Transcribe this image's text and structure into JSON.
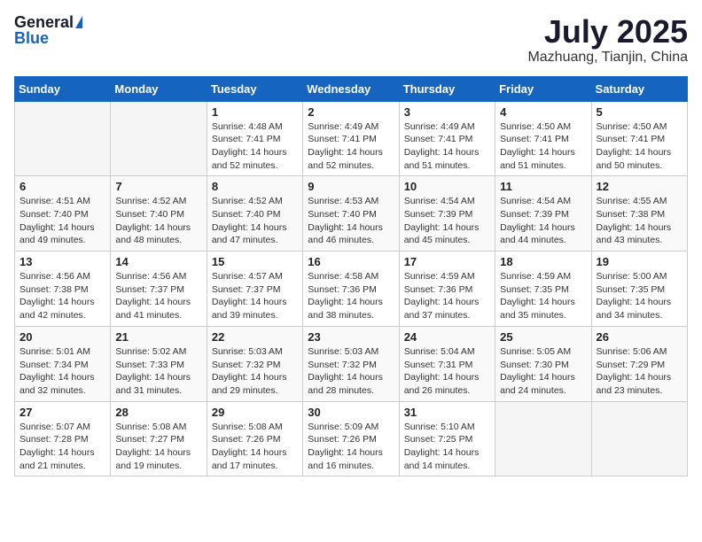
{
  "header": {
    "logo_general": "General",
    "logo_blue": "Blue",
    "month": "July 2025",
    "location": "Mazhuang, Tianjin, China"
  },
  "days_of_week": [
    "Sunday",
    "Monday",
    "Tuesday",
    "Wednesday",
    "Thursday",
    "Friday",
    "Saturday"
  ],
  "weeks": [
    [
      {
        "day": "",
        "sunrise": "",
        "sunset": "",
        "daylight": ""
      },
      {
        "day": "",
        "sunrise": "",
        "sunset": "",
        "daylight": ""
      },
      {
        "day": "1",
        "sunrise": "Sunrise: 4:48 AM",
        "sunset": "Sunset: 7:41 PM",
        "daylight": "Daylight: 14 hours and 52 minutes."
      },
      {
        "day": "2",
        "sunrise": "Sunrise: 4:49 AM",
        "sunset": "Sunset: 7:41 PM",
        "daylight": "Daylight: 14 hours and 52 minutes."
      },
      {
        "day": "3",
        "sunrise": "Sunrise: 4:49 AM",
        "sunset": "Sunset: 7:41 PM",
        "daylight": "Daylight: 14 hours and 51 minutes."
      },
      {
        "day": "4",
        "sunrise": "Sunrise: 4:50 AM",
        "sunset": "Sunset: 7:41 PM",
        "daylight": "Daylight: 14 hours and 51 minutes."
      },
      {
        "day": "5",
        "sunrise": "Sunrise: 4:50 AM",
        "sunset": "Sunset: 7:41 PM",
        "daylight": "Daylight: 14 hours and 50 minutes."
      }
    ],
    [
      {
        "day": "6",
        "sunrise": "Sunrise: 4:51 AM",
        "sunset": "Sunset: 7:40 PM",
        "daylight": "Daylight: 14 hours and 49 minutes."
      },
      {
        "day": "7",
        "sunrise": "Sunrise: 4:52 AM",
        "sunset": "Sunset: 7:40 PM",
        "daylight": "Daylight: 14 hours and 48 minutes."
      },
      {
        "day": "8",
        "sunrise": "Sunrise: 4:52 AM",
        "sunset": "Sunset: 7:40 PM",
        "daylight": "Daylight: 14 hours and 47 minutes."
      },
      {
        "day": "9",
        "sunrise": "Sunrise: 4:53 AM",
        "sunset": "Sunset: 7:40 PM",
        "daylight": "Daylight: 14 hours and 46 minutes."
      },
      {
        "day": "10",
        "sunrise": "Sunrise: 4:54 AM",
        "sunset": "Sunset: 7:39 PM",
        "daylight": "Daylight: 14 hours and 45 minutes."
      },
      {
        "day": "11",
        "sunrise": "Sunrise: 4:54 AM",
        "sunset": "Sunset: 7:39 PM",
        "daylight": "Daylight: 14 hours and 44 minutes."
      },
      {
        "day": "12",
        "sunrise": "Sunrise: 4:55 AM",
        "sunset": "Sunset: 7:38 PM",
        "daylight": "Daylight: 14 hours and 43 minutes."
      }
    ],
    [
      {
        "day": "13",
        "sunrise": "Sunrise: 4:56 AM",
        "sunset": "Sunset: 7:38 PM",
        "daylight": "Daylight: 14 hours and 42 minutes."
      },
      {
        "day": "14",
        "sunrise": "Sunrise: 4:56 AM",
        "sunset": "Sunset: 7:37 PM",
        "daylight": "Daylight: 14 hours and 41 minutes."
      },
      {
        "day": "15",
        "sunrise": "Sunrise: 4:57 AM",
        "sunset": "Sunset: 7:37 PM",
        "daylight": "Daylight: 14 hours and 39 minutes."
      },
      {
        "day": "16",
        "sunrise": "Sunrise: 4:58 AM",
        "sunset": "Sunset: 7:36 PM",
        "daylight": "Daylight: 14 hours and 38 minutes."
      },
      {
        "day": "17",
        "sunrise": "Sunrise: 4:59 AM",
        "sunset": "Sunset: 7:36 PM",
        "daylight": "Daylight: 14 hours and 37 minutes."
      },
      {
        "day": "18",
        "sunrise": "Sunrise: 4:59 AM",
        "sunset": "Sunset: 7:35 PM",
        "daylight": "Daylight: 14 hours and 35 minutes."
      },
      {
        "day": "19",
        "sunrise": "Sunrise: 5:00 AM",
        "sunset": "Sunset: 7:35 PM",
        "daylight": "Daylight: 14 hours and 34 minutes."
      }
    ],
    [
      {
        "day": "20",
        "sunrise": "Sunrise: 5:01 AM",
        "sunset": "Sunset: 7:34 PM",
        "daylight": "Daylight: 14 hours and 32 minutes."
      },
      {
        "day": "21",
        "sunrise": "Sunrise: 5:02 AM",
        "sunset": "Sunset: 7:33 PM",
        "daylight": "Daylight: 14 hours and 31 minutes."
      },
      {
        "day": "22",
        "sunrise": "Sunrise: 5:03 AM",
        "sunset": "Sunset: 7:32 PM",
        "daylight": "Daylight: 14 hours and 29 minutes."
      },
      {
        "day": "23",
        "sunrise": "Sunrise: 5:03 AM",
        "sunset": "Sunset: 7:32 PM",
        "daylight": "Daylight: 14 hours and 28 minutes."
      },
      {
        "day": "24",
        "sunrise": "Sunrise: 5:04 AM",
        "sunset": "Sunset: 7:31 PM",
        "daylight": "Daylight: 14 hours and 26 minutes."
      },
      {
        "day": "25",
        "sunrise": "Sunrise: 5:05 AM",
        "sunset": "Sunset: 7:30 PM",
        "daylight": "Daylight: 14 hours and 24 minutes."
      },
      {
        "day": "26",
        "sunrise": "Sunrise: 5:06 AM",
        "sunset": "Sunset: 7:29 PM",
        "daylight": "Daylight: 14 hours and 23 minutes."
      }
    ],
    [
      {
        "day": "27",
        "sunrise": "Sunrise: 5:07 AM",
        "sunset": "Sunset: 7:28 PM",
        "daylight": "Daylight: 14 hours and 21 minutes."
      },
      {
        "day": "28",
        "sunrise": "Sunrise: 5:08 AM",
        "sunset": "Sunset: 7:27 PM",
        "daylight": "Daylight: 14 hours and 19 minutes."
      },
      {
        "day": "29",
        "sunrise": "Sunrise: 5:08 AM",
        "sunset": "Sunset: 7:26 PM",
        "daylight": "Daylight: 14 hours and 17 minutes."
      },
      {
        "day": "30",
        "sunrise": "Sunrise: 5:09 AM",
        "sunset": "Sunset: 7:26 PM",
        "daylight": "Daylight: 14 hours and 16 minutes."
      },
      {
        "day": "31",
        "sunrise": "Sunrise: 5:10 AM",
        "sunset": "Sunset: 7:25 PM",
        "daylight": "Daylight: 14 hours and 14 minutes."
      },
      {
        "day": "",
        "sunrise": "",
        "sunset": "",
        "daylight": ""
      },
      {
        "day": "",
        "sunrise": "",
        "sunset": "",
        "daylight": ""
      }
    ]
  ]
}
